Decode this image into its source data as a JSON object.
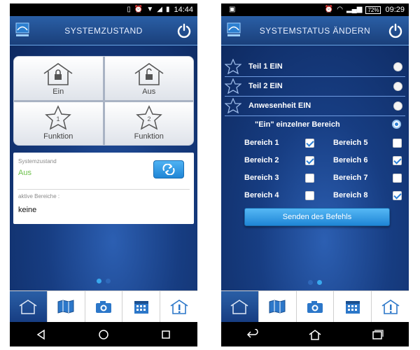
{
  "left": {
    "status": {
      "time": "14:44"
    },
    "title": "SYSTEMZUSTAND",
    "tiles": [
      {
        "label": "Ein",
        "icon": "house-lock-closed-icon"
      },
      {
        "label": "Aus",
        "icon": "house-lock-open-icon"
      },
      {
        "label": "Funktion",
        "icon": "star-1-icon",
        "badge": "1"
      },
      {
        "label": "Funktion",
        "icon": "star-2-icon",
        "badge": "2"
      }
    ],
    "card": {
      "state_label": "Systemzustand",
      "state_value": "Aus",
      "areas_label": "aktive Bereiche :",
      "areas_value": "keine"
    },
    "page_index": 0,
    "page_count": 2
  },
  "right": {
    "status": {
      "time": "09:29",
      "battery": "72%"
    },
    "title": "SYSTEMSTATUS ÄNDERN",
    "options": [
      {
        "label": "Teil 1 EIN",
        "selected": false
      },
      {
        "label": "Teil 2 EIN",
        "selected": false
      },
      {
        "label": "Anwesenheit EIN",
        "selected": false
      }
    ],
    "single_area": {
      "label": "\"Ein\" einzelner Bereich",
      "selected": true
    },
    "areas": [
      {
        "label": "Bereich 1",
        "checked": true
      },
      {
        "label": "Bereich 2",
        "checked": true
      },
      {
        "label": "Bereich 3",
        "checked": false
      },
      {
        "label": "Bereich 4",
        "checked": false
      },
      {
        "label": "Bereich 5",
        "checked": false
      },
      {
        "label": "Bereich 6",
        "checked": true
      },
      {
        "label": "Bereich 7",
        "checked": false
      },
      {
        "label": "Bereich 8",
        "checked": true
      }
    ],
    "send_label": "Senden des Befehls",
    "page_index": 1,
    "page_count": 2
  },
  "bottom_nav": [
    "home-icon",
    "map-icon",
    "camera-icon",
    "calendar-icon",
    "house-alert-icon"
  ],
  "colors": {
    "accent": "#39a9ee",
    "value_green": "#6cc04a",
    "bar_dark": "#173d82"
  }
}
